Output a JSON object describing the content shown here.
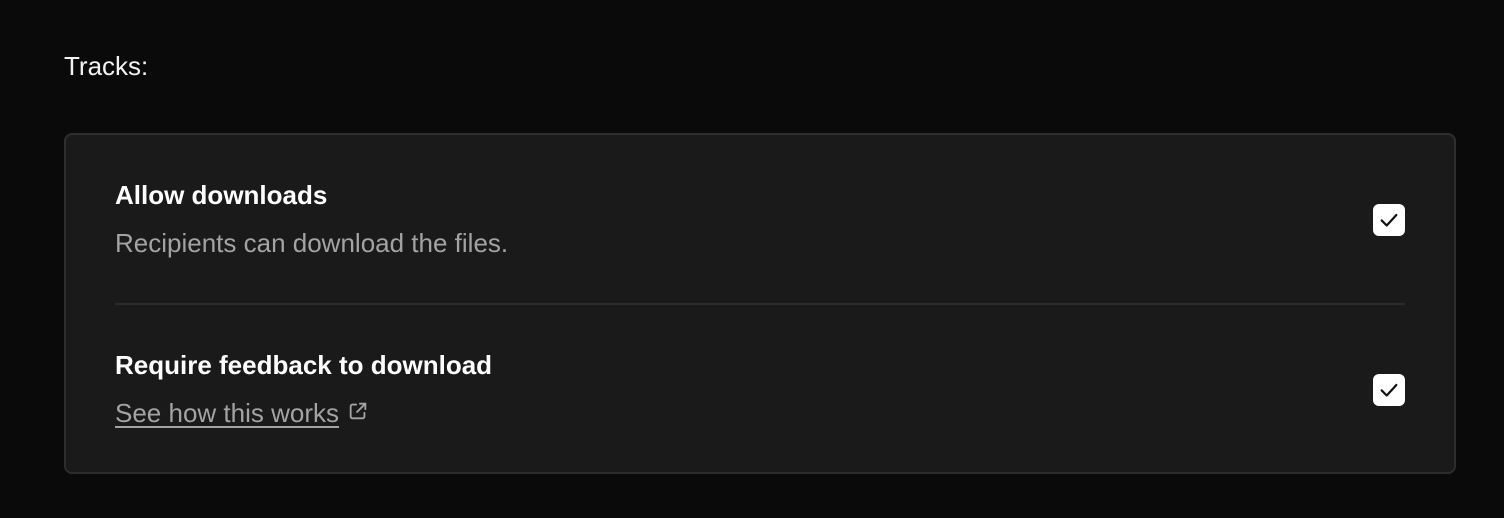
{
  "section": {
    "label": "Tracks:"
  },
  "options": [
    {
      "title": "Allow downloads",
      "description": "Recipients can download the files.",
      "checked": true
    },
    {
      "title": "Require feedback to download",
      "link_text": "See how this works",
      "link_icon": "external-link-icon",
      "checked": true
    }
  ],
  "colors": {
    "background": "#0a0a0a",
    "panel": "#1a1a1a",
    "border": "#2e2e2e",
    "muted_text": "#a3a3a3",
    "checkbox": "#ffffff"
  }
}
